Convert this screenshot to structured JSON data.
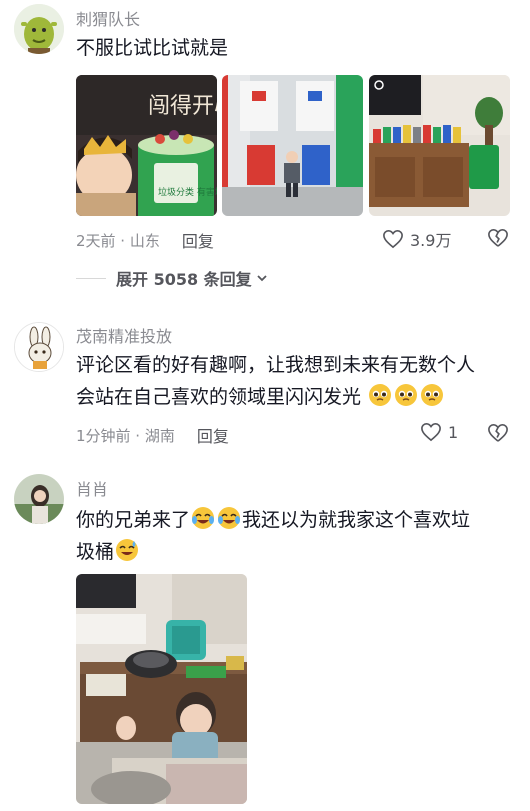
{
  "comments": [
    {
      "username": "刺猬队长",
      "content": "不服比试比试就是",
      "time_location": "2天前 · 山东",
      "reply_label": "回复",
      "likes": "3.9万",
      "expand_label": "展开 5058 条回复",
      "photo1_text": {
        "line1": "闯得开心",
        "cake": "垃圾分类 有害垃圾"
      }
    },
    {
      "username": "茂南精准投放",
      "content_line1": "评论区看的好有趣啊，让我想到未来有无数个人",
      "content_line2": "会站在自己喜欢的领域里闪闪发光",
      "time_location": "1分钟前 · 湖南",
      "reply_label": "回复",
      "likes": "1"
    },
    {
      "username": "肖肖",
      "content_part1": "你的兄弟来了",
      "content_part2": "我还以为就我家这个喜欢垃",
      "content_part3": "圾桶"
    }
  ],
  "colors": {
    "username": "#8a8b91",
    "text": "#161823",
    "meta": "#8a8b91",
    "bin_green": "#1f9a48",
    "bin_red": "#d83a33",
    "bin_blue": "#2f62c9",
    "bin_gray": "#7c7f86"
  },
  "icons": [
    "heart-outline-icon",
    "broken-heart-icon",
    "chevron-down-icon",
    "crying-laughing-emoji",
    "pleading-face-emoji",
    "sweat-smile-emoji"
  ]
}
